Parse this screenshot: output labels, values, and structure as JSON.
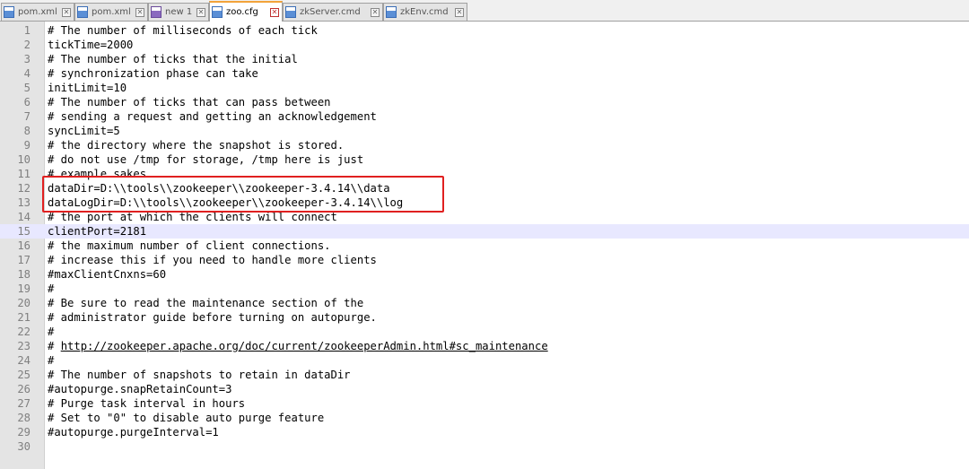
{
  "tabs": [
    {
      "label": "pom.xml",
      "icon": "file-icon",
      "active": false
    },
    {
      "label": "pom.xml",
      "icon": "file-icon",
      "active": false
    },
    {
      "label": "new 1",
      "icon": "new-file-icon",
      "active": false
    },
    {
      "label": "zoo.cfg",
      "icon": "file-icon",
      "active": true
    },
    {
      "label": "zkServer.cmd",
      "icon": "file-icon",
      "active": false
    },
    {
      "label": "zkEnv.cmd",
      "icon": "file-icon",
      "active": false
    }
  ],
  "editor": {
    "current_line": 15,
    "highlighted_lines": [
      12,
      13
    ],
    "highlight_color": "#e02020",
    "lines": [
      {
        "n": "1",
        "text": "# The number of milliseconds of each tick"
      },
      {
        "n": "2",
        "text": "tickTime=2000"
      },
      {
        "n": "3",
        "text": "# The number of ticks that the initial"
      },
      {
        "n": "4",
        "text": "# synchronization phase can take"
      },
      {
        "n": "5",
        "text": "initLimit=10"
      },
      {
        "n": "6",
        "text": "# The number of ticks that can pass between"
      },
      {
        "n": "7",
        "text": "# sending a request and getting an acknowledgement"
      },
      {
        "n": "8",
        "text": "syncLimit=5"
      },
      {
        "n": "9",
        "text": "# the directory where the snapshot is stored."
      },
      {
        "n": "10",
        "text": "# do not use /tmp for storage, /tmp here is just"
      },
      {
        "n": "11",
        "text": "# example sakes."
      },
      {
        "n": "12",
        "text": "dataDir=D:\\\\tools\\\\zookeeper\\\\zookeeper-3.4.14\\\\data"
      },
      {
        "n": "13",
        "text": "dataLogDir=D:\\\\tools\\\\zookeeper\\\\zookeeper-3.4.14\\\\log"
      },
      {
        "n": "14",
        "text": "# the port at which the clients will connect"
      },
      {
        "n": "15",
        "text": "clientPort=2181"
      },
      {
        "n": "16",
        "text": "# the maximum number of client connections."
      },
      {
        "n": "17",
        "text": "# increase this if you need to handle more clients"
      },
      {
        "n": "18",
        "text": "#maxClientCnxns=60"
      },
      {
        "n": "19",
        "text": "#"
      },
      {
        "n": "20",
        "text": "# Be sure to read the maintenance section of the"
      },
      {
        "n": "21",
        "text": "# administrator guide before turning on autopurge."
      },
      {
        "n": "22",
        "text": "#"
      },
      {
        "n": "23",
        "text": "# http://zookeeper.apache.org/doc/current/zookeeperAdmin.html#sc_maintenance",
        "url_start": 2
      },
      {
        "n": "24",
        "text": "#"
      },
      {
        "n": "25",
        "text": "# The number of snapshots to retain in dataDir"
      },
      {
        "n": "26",
        "text": "#autopurge.snapRetainCount=3"
      },
      {
        "n": "27",
        "text": "# Purge task interval in hours"
      },
      {
        "n": "28",
        "text": "# Set to \"0\" to disable auto purge feature"
      },
      {
        "n": "29",
        "text": "#autopurge.purgeInterval=1"
      },
      {
        "n": "30",
        "text": ""
      }
    ]
  }
}
